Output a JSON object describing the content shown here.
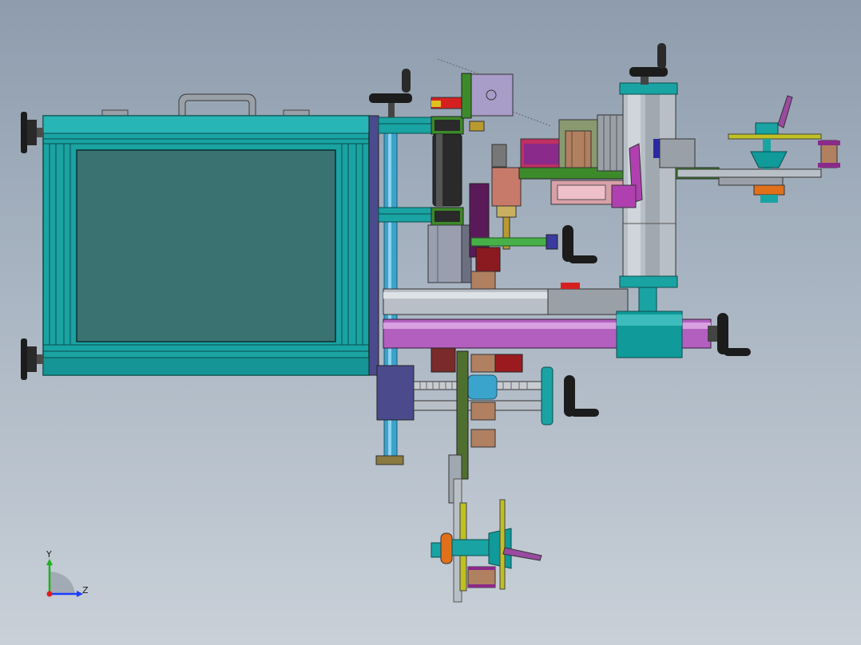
{
  "viewport": {
    "background_top": "#8e9cad",
    "background_bottom": "#c9d0d8"
  },
  "triad": {
    "y_label": "Y",
    "z_label": "Z",
    "y_color": "#1db31d",
    "z_color": "#1d3cff",
    "x_color": "#e11d1d"
  },
  "colors": {
    "frame_cyan": "#1aa3a3",
    "panel_teal": "#3a7272",
    "slate_blue": "#4a4a8c",
    "steel_grey": "#b8bfc6",
    "magenta_roller": "#b35fbf",
    "teal_housing": "#109a9a",
    "dark_knob": "#1c1c1c",
    "bronze_roll": "#b08060",
    "green_plate": "#3d8a2a",
    "olive_belt": "#4f6f2f"
  }
}
